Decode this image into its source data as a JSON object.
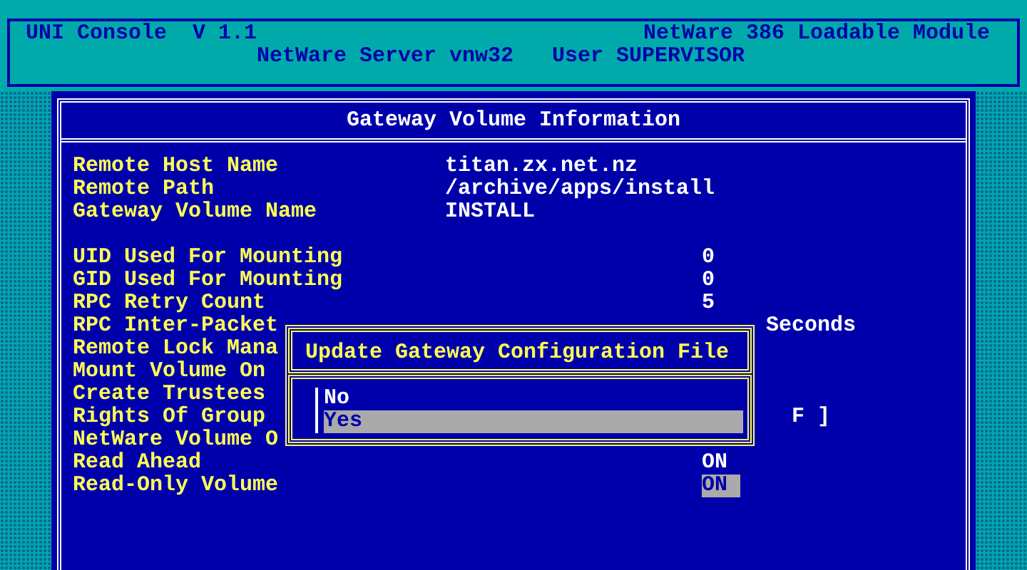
{
  "header": {
    "app": "UNI Console",
    "version": "V 1.1",
    "module": "NetWare 386 Loadable Module",
    "server": "NetWare Server vnw32",
    "user": "User SUPERVISOR"
  },
  "window": {
    "title": "Gateway Volume Information",
    "groups": [
      [
        {
          "label": "Remote Host Name",
          "value": "titan.zx.net.nz",
          "kind": "text",
          "selected": false
        },
        {
          "label": "Remote Path",
          "value": "/archive/apps/install",
          "kind": "text",
          "selected": false
        },
        {
          "label": "Gateway Volume Name",
          "value": "INSTALL",
          "kind": "text",
          "selected": false
        }
      ],
      [
        {
          "label": "UID Used For Mounting",
          "value": "0",
          "kind": "setting",
          "selected": false
        },
        {
          "label": "GID Used For Mounting",
          "value": "0",
          "kind": "setting",
          "selected": false
        },
        {
          "label": "RPC Retry Count",
          "value": "5",
          "kind": "setting",
          "selected": false
        },
        {
          "label": "RPC Inter-Packet",
          "value": "Seconds",
          "kind": "unit",
          "selected": false
        },
        {
          "label": "Remote Lock Mana",
          "kind": "label",
          "selected": false
        },
        {
          "label": "Mount Volume On",
          "kind": "label",
          "selected": false
        },
        {
          "label": "Create Trustees",
          "kind": "label",
          "selected": false
        },
        {
          "label": "Rights Of Group",
          "value": "F ]",
          "kind": "rights",
          "selected": false
        },
        {
          "label": "NetWare Volume O",
          "kind": "label",
          "selected": false
        },
        {
          "label": "Read Ahead",
          "value": "ON",
          "kind": "setting",
          "selected": false
        },
        {
          "label": "Read-Only Volume",
          "value": "ON",
          "kind": "setting",
          "selected": true
        }
      ]
    ]
  },
  "dialog": {
    "title": "Update Gateway Configuration File",
    "options": [
      {
        "label": "No",
        "selected": false
      },
      {
        "label": "Yes",
        "selected": true
      }
    ]
  }
}
